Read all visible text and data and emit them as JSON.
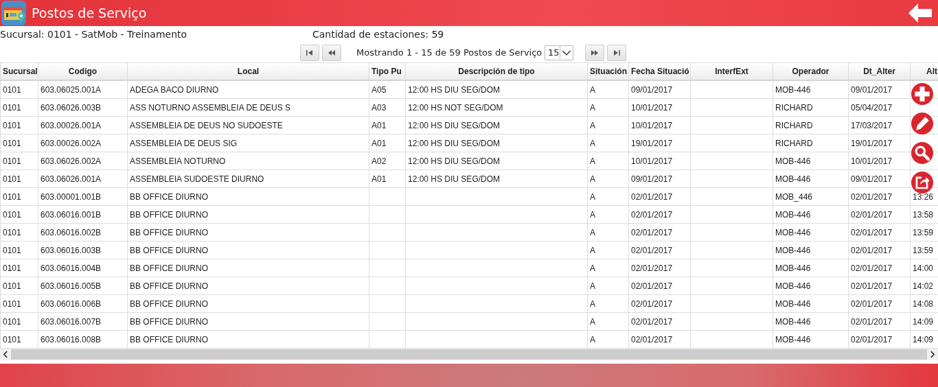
{
  "header": {
    "title": "Postos de Serviço"
  },
  "info": {
    "branch": "Sucursal: 0101 - SatMob - Treinamento",
    "count": "Cantidad de estaciones: 59"
  },
  "pager": {
    "text": "Mostrando 1 - 15 de 59 Postos de Serviço",
    "page_size": "15"
  },
  "table": {
    "columns": [
      "Sucursal",
      "Codigo",
      "Local",
      "Tipo Pu",
      "Descripción de tipo",
      "Situación",
      "Fecha Situació",
      "InterfExt",
      "Operador",
      "Dt_Alter",
      "Alt"
    ],
    "rows": [
      {
        "cells": [
          "0101",
          "603.06025.001A",
          "ADEGA BACO DIURNO",
          "A05",
          "12:00 HS DIU SEG/DOM",
          "A",
          "09/01/2017",
          "",
          "MOB-446",
          "09/01/2017"
        ]
      },
      {
        "cells": [
          "0101",
          "603.06026.003B",
          "ASS NOTURNO ASSEMBLEIA DE DEUS S",
          "A03",
          "12:00 HS NOT SEG/DOM",
          "A",
          "10/01/2017",
          "",
          "RICHARD",
          "05/04/2017"
        ]
      },
      {
        "cells": [
          "0101",
          "603.00026.001A",
          "ASSEMBLEIA DE DEUS NO SUDOESTE",
          "A01",
          "12:00 HS DIU SEG/DOM",
          "A",
          "10/01/2017",
          "",
          "RICHARD",
          "17/03/2017"
        ]
      },
      {
        "cells": [
          "0101",
          "603.00026.002A",
          "ASSEMBLEIA DE DEUS SIG",
          "A01",
          "12:00 HS DIU SEG/DOM",
          "A",
          "19/01/2017",
          "",
          "RICHARD",
          "19/01/2017"
        ]
      },
      {
        "cells": [
          "0101",
          "603.06026.002A",
          "ASSEMBLEIA NOTURNO",
          "A02",
          "12:00 HS DIU SEG/DOM",
          "A",
          "10/01/2017",
          "",
          "MOB-446",
          "10/01/2017"
        ]
      },
      {
        "cells": [
          "0101",
          "603.06026.001A",
          "ASSEMBLEIA SUDOESTE DIURNO",
          "A01",
          "12:00 HS DIU SEG/DOM",
          "A",
          "09/01/2017",
          "",
          "MOB-446",
          "09/01/2017"
        ]
      },
      {
        "cells": [
          "0101",
          "603.00001.001B",
          "BB OFFICE DIURNO",
          "",
          "",
          "A",
          "02/01/2017",
          "",
          "MOB_446",
          "02/01/2017",
          "13:26"
        ]
      },
      {
        "cells": [
          "0101",
          "603.06016.001B",
          "BB OFFICE DIURNO",
          "",
          "",
          "A",
          "02/01/2017",
          "",
          "MOB-446",
          "02/01/2017",
          "13:58"
        ]
      },
      {
        "cells": [
          "0101",
          "603.06016.002B",
          "BB OFFICE DIURNO",
          "",
          "",
          "A",
          "02/01/2017",
          "",
          "MOB-446",
          "02/01/2017",
          "13:59"
        ]
      },
      {
        "cells": [
          "0101",
          "603.06016.003B",
          "BB OFFICE DIURNO",
          "",
          "",
          "A",
          "02/01/2017",
          "",
          "MOB-446",
          "02/01/2017",
          "13:59"
        ]
      },
      {
        "cells": [
          "0101",
          "603.06016.004B",
          "BB OFFICE DIURNO",
          "",
          "",
          "A",
          "02/01/2017",
          "",
          "MOB-446",
          "02/01/2017",
          "14:00"
        ]
      },
      {
        "cells": [
          "0101",
          "603.06016.005B",
          "BB OFFICE DIURNO",
          "",
          "",
          "A",
          "02/01/2017",
          "",
          "MOB-446",
          "02/01/2017",
          "14:02"
        ]
      },
      {
        "cells": [
          "0101",
          "603.06016.006B",
          "BB OFFICE DIURNO",
          "",
          "",
          "A",
          "02/01/2017",
          "",
          "MOB-446",
          "02/01/2017",
          "14:08"
        ]
      },
      {
        "cells": [
          "0101",
          "603.06016.007B",
          "BB OFFICE DIURNO",
          "",
          "",
          "A",
          "02/01/2017",
          "",
          "MOB-446",
          "02/01/2017",
          "14:09"
        ]
      },
      {
        "cells": [
          "0101",
          "603.06016.008B",
          "BB OFFICE DIURNO",
          "",
          "",
          "A",
          "02/01/2017",
          "",
          "MOB-446",
          "02/01/2017",
          "14:09"
        ]
      }
    ]
  }
}
